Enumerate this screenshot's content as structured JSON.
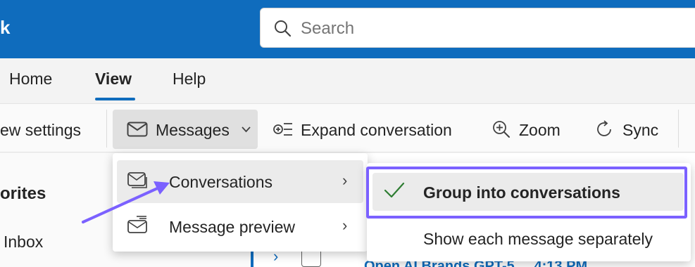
{
  "app": {
    "title_fragment": "k"
  },
  "search": {
    "placeholder": "Search"
  },
  "tabs": [
    {
      "label": "Home",
      "active": false
    },
    {
      "label": "View",
      "active": true
    },
    {
      "label": "Help",
      "active": false
    }
  ],
  "ribbon": {
    "view_settings_label": "ew settings",
    "messages_label": "Messages",
    "expand_conversation_label": "Expand conversation",
    "zoom_label": "Zoom",
    "sync_label": "Sync"
  },
  "nav": {
    "favorites_label": "orites",
    "inbox_label": "Inbox"
  },
  "message_list": {
    "partial_preview": "Open AI Brands GPT-5 ... 4:13 PM"
  },
  "messages_menu": {
    "items": [
      {
        "label": "Conversations",
        "icon": "conversations-icon",
        "has_submenu": true,
        "highlighted": true
      },
      {
        "label": "Message preview",
        "icon": "message-preview-icon",
        "has_submenu": true,
        "highlighted": false
      }
    ]
  },
  "conversations_submenu": {
    "items": [
      {
        "label": "Group into conversations",
        "checked": true
      },
      {
        "label": "Show each message separately",
        "checked": false
      }
    ]
  },
  "colors": {
    "brand": "#0f6cbd",
    "annotation": "#7b61ff",
    "check": "#2e7d32"
  }
}
